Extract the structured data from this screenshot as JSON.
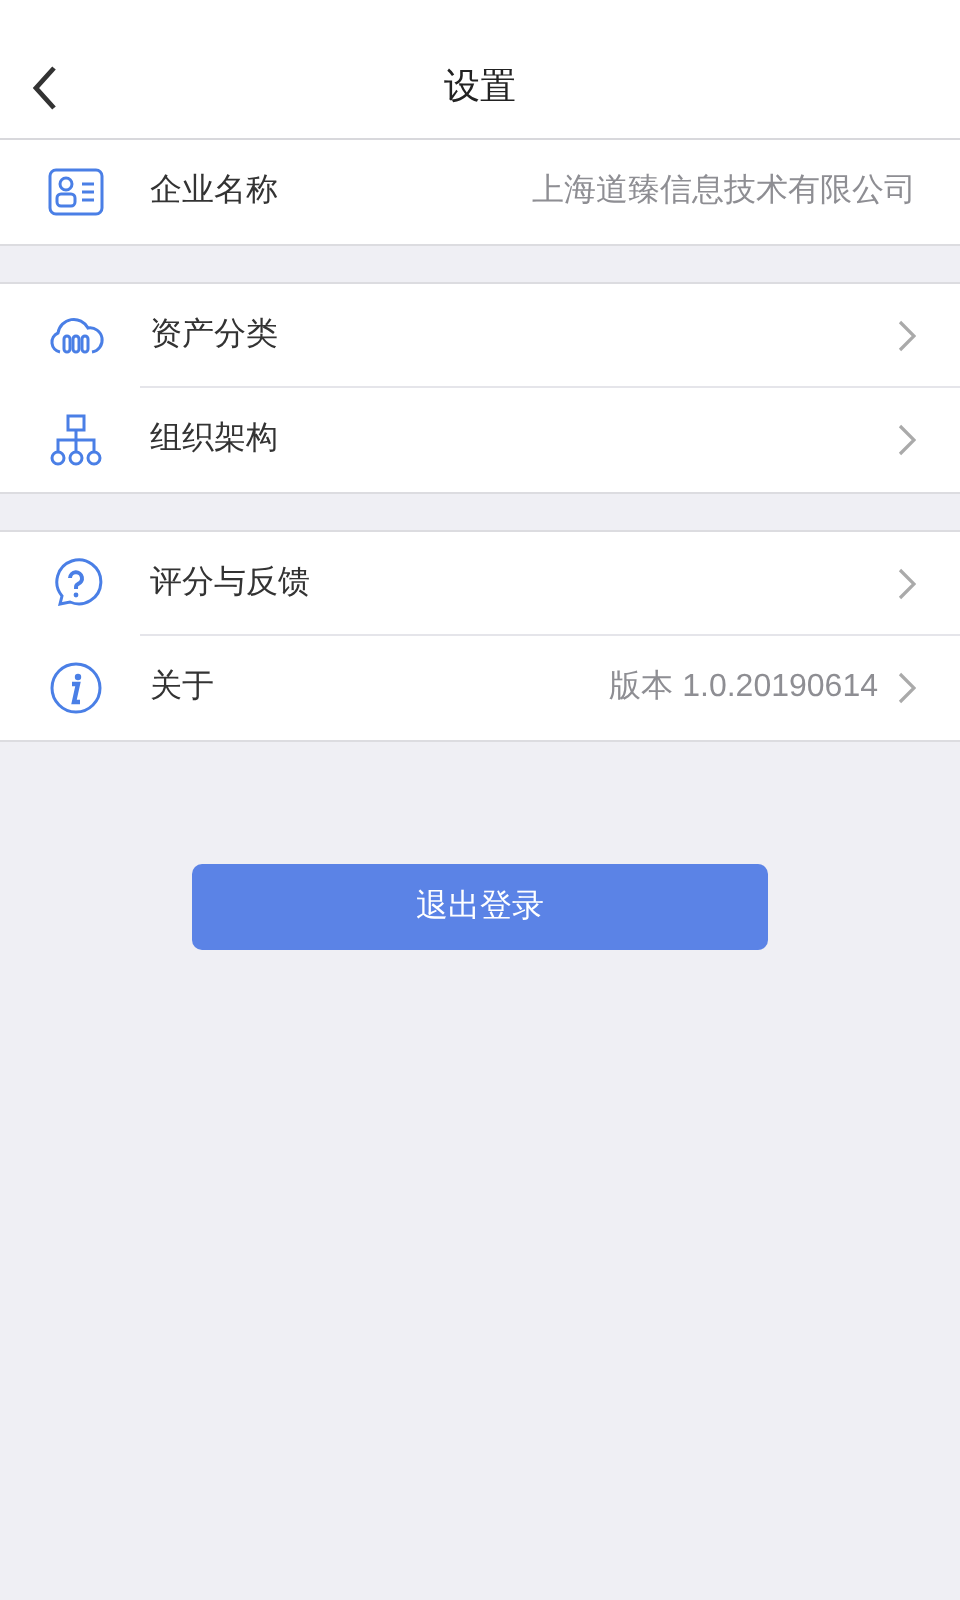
{
  "header": {
    "title": "设置"
  },
  "sections": [
    {
      "items": [
        {
          "label": "企业名称",
          "value": "上海道臻信息技术有限公司",
          "chevron": false
        }
      ]
    },
    {
      "items": [
        {
          "label": "资产分类",
          "chevron": true
        },
        {
          "label": "组织架构",
          "chevron": true
        }
      ]
    },
    {
      "items": [
        {
          "label": "评分与反馈",
          "chevron": true
        },
        {
          "label": "关于",
          "value": "版本 1.0.20190614",
          "chevron": true
        }
      ]
    }
  ],
  "logout_button": "退出登录"
}
